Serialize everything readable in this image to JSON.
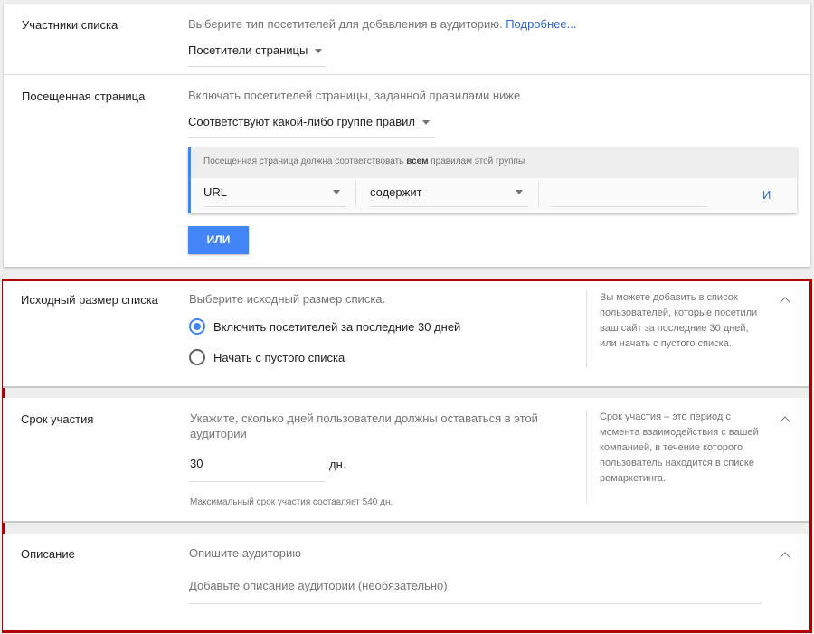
{
  "members": {
    "label": "Участники списка",
    "hint": "Выберите тип посетителей для добавления в аудиторию.",
    "link": "Подробнее...",
    "select": "Посетители страницы"
  },
  "visited": {
    "label": "Посещенная страница",
    "hint": "Включать посетителей страницы, заданной правилами ниже",
    "select": "Соответствуют какой-либо группе правил",
    "group": {
      "header_pre": "Посещенная страница должна соответствовать ",
      "header_bold": "всем",
      "header_post": " правилам этой группы",
      "field": "URL",
      "operator": "содержит",
      "value": "",
      "and": "И"
    },
    "or_button": "ИЛИ"
  },
  "initial_size": {
    "label": "Исходный размер списка",
    "hint": "Выберите исходный размер списка.",
    "options": [
      {
        "label": "Включить посетителей за последние 30 дней",
        "selected": true
      },
      {
        "label": "Начать с пустого списка",
        "selected": false
      }
    ],
    "help": "Вы можете добавить в список пользователей, которые посетили ваш сайт за последние 30 дней, или начать с пустого списка."
  },
  "duration": {
    "label": "Срок участия",
    "hint": "Укажите, сколько дней пользователи должны оставаться в этой аудитории",
    "value": "30",
    "unit": "дн.",
    "note": "Максимальный срок участия составляет 540 дн.",
    "help": "Срок участия – это период с момента взаимодействия с вашей компанией, в течение которого пользователь находится в списке ремаркетинга."
  },
  "description": {
    "label": "Описание",
    "hint": "Опишите аудиторию",
    "placeholder": "Добавьте описание аудитории (необязательно)"
  },
  "colors": {
    "accent": "#4285f4",
    "highlight": "#b00000"
  }
}
